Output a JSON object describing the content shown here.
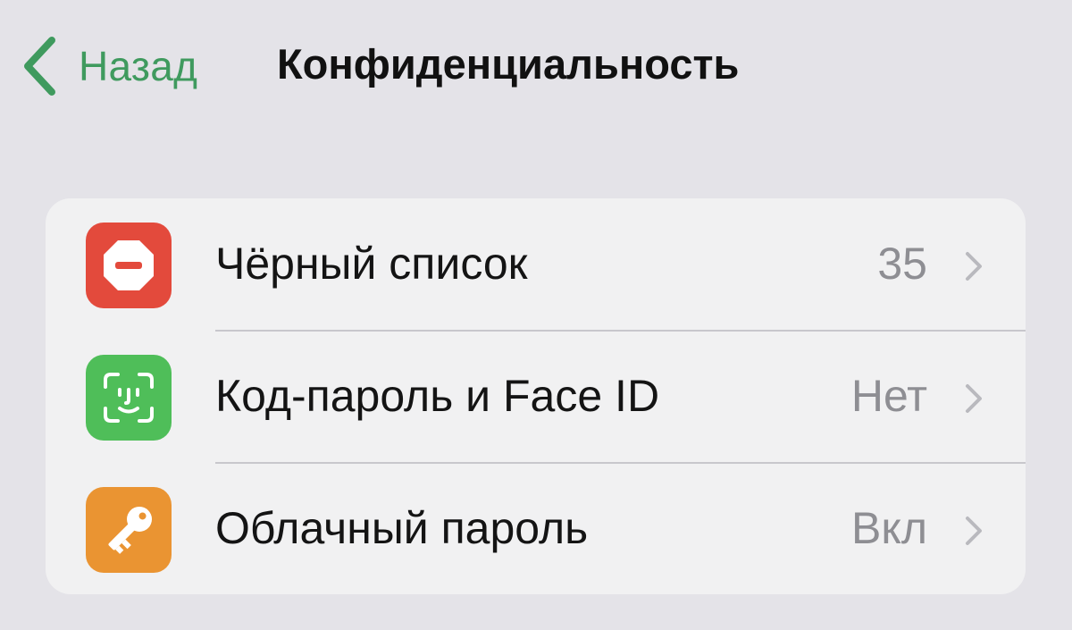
{
  "nav": {
    "back_label": "Назад",
    "back_icon": "chevron-left-icon",
    "title": "Конфиденциальность",
    "accent_color": "#3f9a5e"
  },
  "settings": {
    "items": [
      {
        "label": "Чёрный список",
        "value": "35",
        "icon": "blocked-icon",
        "icon_color": "#e34a3c"
      },
      {
        "label": "Код-пароль и Face ID",
        "value": "Нет",
        "icon": "face-id-icon",
        "icon_color": "#4fbe59"
      },
      {
        "label": "Облачный пароль",
        "value": "Вкл",
        "icon": "key-icon",
        "icon_color": "#ea9432"
      }
    ]
  }
}
